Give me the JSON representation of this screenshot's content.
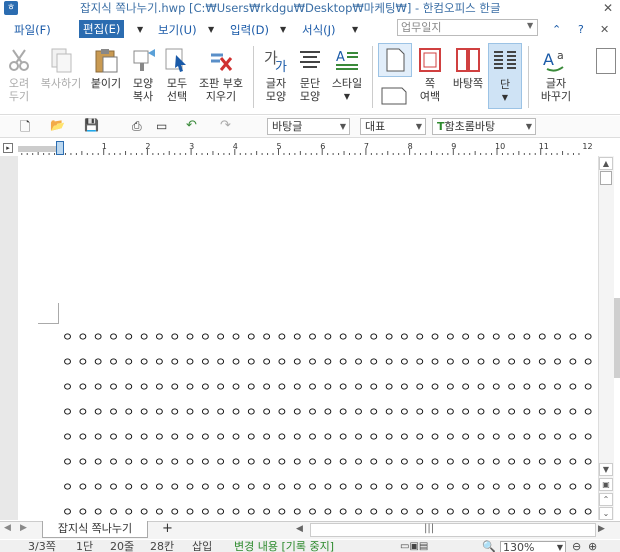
{
  "window": {
    "title": "잡지식 쪽나누기.hwp [C:₩Users₩rkdgu₩Desktop₩마케팅₩] - 한컴오피스 한글",
    "close": "✕"
  },
  "menubar": {
    "items": [
      "파일(F)",
      "편집(E)",
      "보기(U)",
      "입력(D)",
      "서식(J)"
    ],
    "memo_placeholder": "업무일지",
    "help": "?"
  },
  "ribbon": {
    "cut": "오려\n두기",
    "copy": "복사하기",
    "paste": "붙이기",
    "shape_copy": "모양\n복사",
    "select_all": "모두\n선택",
    "clear_marks": "조판 부호\n지우기",
    "char_shape": "글자\n모양",
    "para_shape": "문단\n모양",
    "style": "스타일",
    "page_margin": "쪽\n여백",
    "background": "바탕쪽",
    "columns": "단",
    "char_change": "글자\n바꾸기"
  },
  "toolbar": {
    "style_combo": "바탕글",
    "font_lang": "대표",
    "font_name": "함초롬바탕"
  },
  "ruler": {
    "ticks": [
      "1",
      "2",
      "3",
      "4",
      "5",
      "6",
      "7",
      "8",
      "9",
      "10",
      "11",
      "12"
    ]
  },
  "document": {
    "symbol": "ㅇ",
    "rows": 8,
    "cols": 35
  },
  "tabs": {
    "sheet": "잡지식 쪽나누기",
    "add": "+"
  },
  "status": {
    "page": "3/3쪽",
    "dan": "1단",
    "line": "20줄",
    "col": "28칸",
    "mode": "삽입",
    "track": "변경 내용 [기록 중지]",
    "zoom": "130%"
  }
}
